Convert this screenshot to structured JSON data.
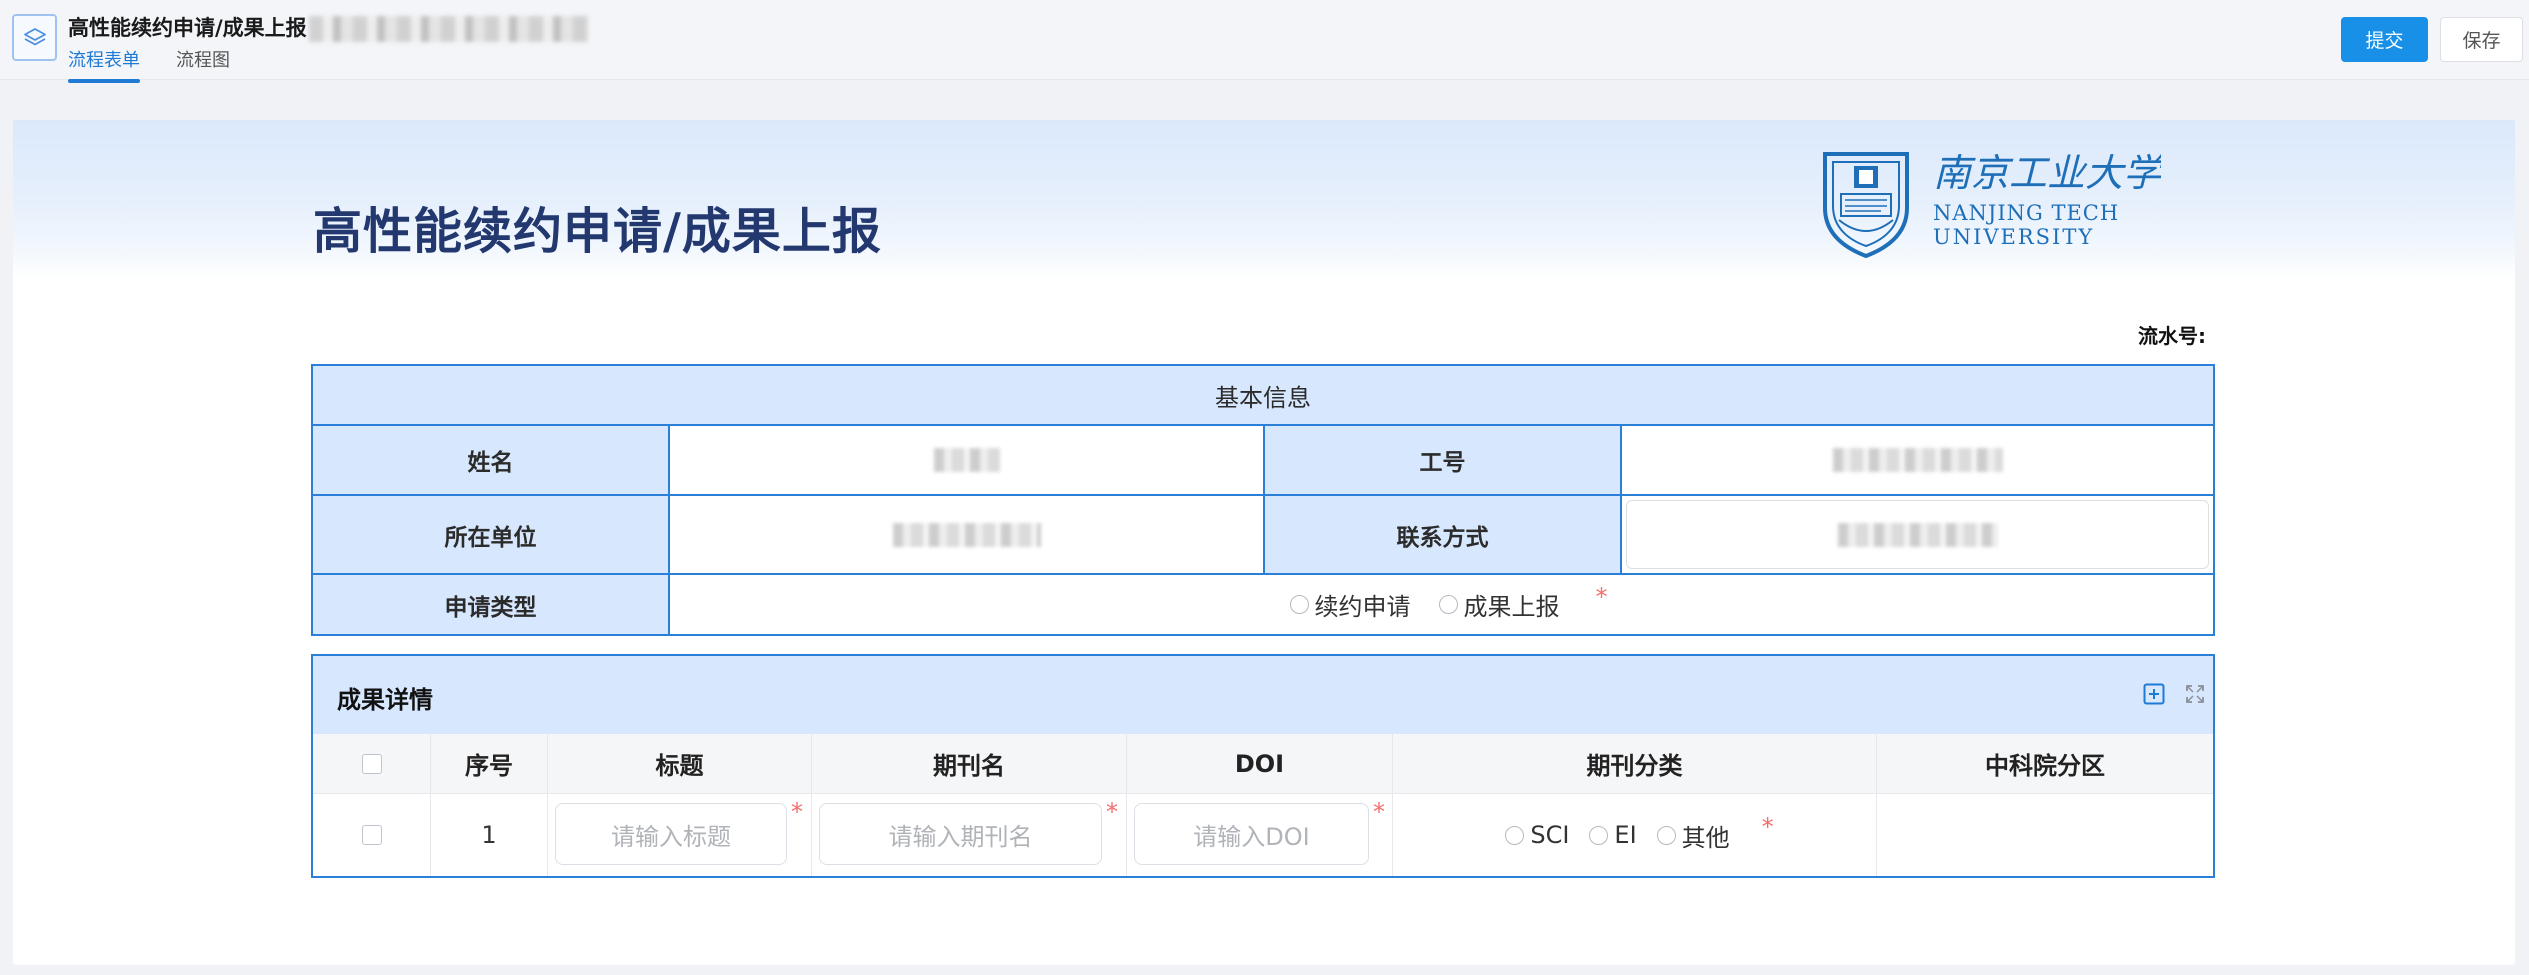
{
  "header": {
    "doc_title": "高性能续约申请/成果上报",
    "tabs": [
      {
        "label": "流程表单",
        "active": true
      },
      {
        "label": "流程图",
        "active": false
      }
    ],
    "submit_label": "提交",
    "save_label": "保存"
  },
  "form": {
    "title": "高性能续约申请/成果上报",
    "logo": {
      "name_line1": "NANJING TECH",
      "name_line2": "UNIVERSITY",
      "calligraphy": "南京工业大学"
    },
    "serial_label": "流水号:",
    "basic_info": {
      "section_title": "基本信息",
      "name_label": "姓名",
      "staff_id_label": "工号",
      "unit_label": "所在单位",
      "contact_label": "联系方式",
      "apply_type_label": "申请类型",
      "apply_type_options": [
        "续约申请",
        "成果上报"
      ],
      "required_mark": "*"
    },
    "results": {
      "section_title": "成果详情",
      "columns": [
        "序号",
        "标题",
        "期刊名",
        "DOI",
        "期刊分类",
        "中科院分区"
      ],
      "rows": [
        {
          "index": "1",
          "title_placeholder": "请输入标题",
          "journal_placeholder": "请输入期刊名",
          "doi_placeholder": "请输入DOI",
          "category_options": [
            "SCI",
            "EI",
            "其他"
          ],
          "cas_zone": ""
        }
      ],
      "required_mark": "*"
    }
  },
  "colors": {
    "primary": "#1890e8",
    "table_border": "#2a7fd6",
    "label_bg": "#d7e7fd",
    "title_color": "#22386e",
    "required": "#f56c6c"
  }
}
